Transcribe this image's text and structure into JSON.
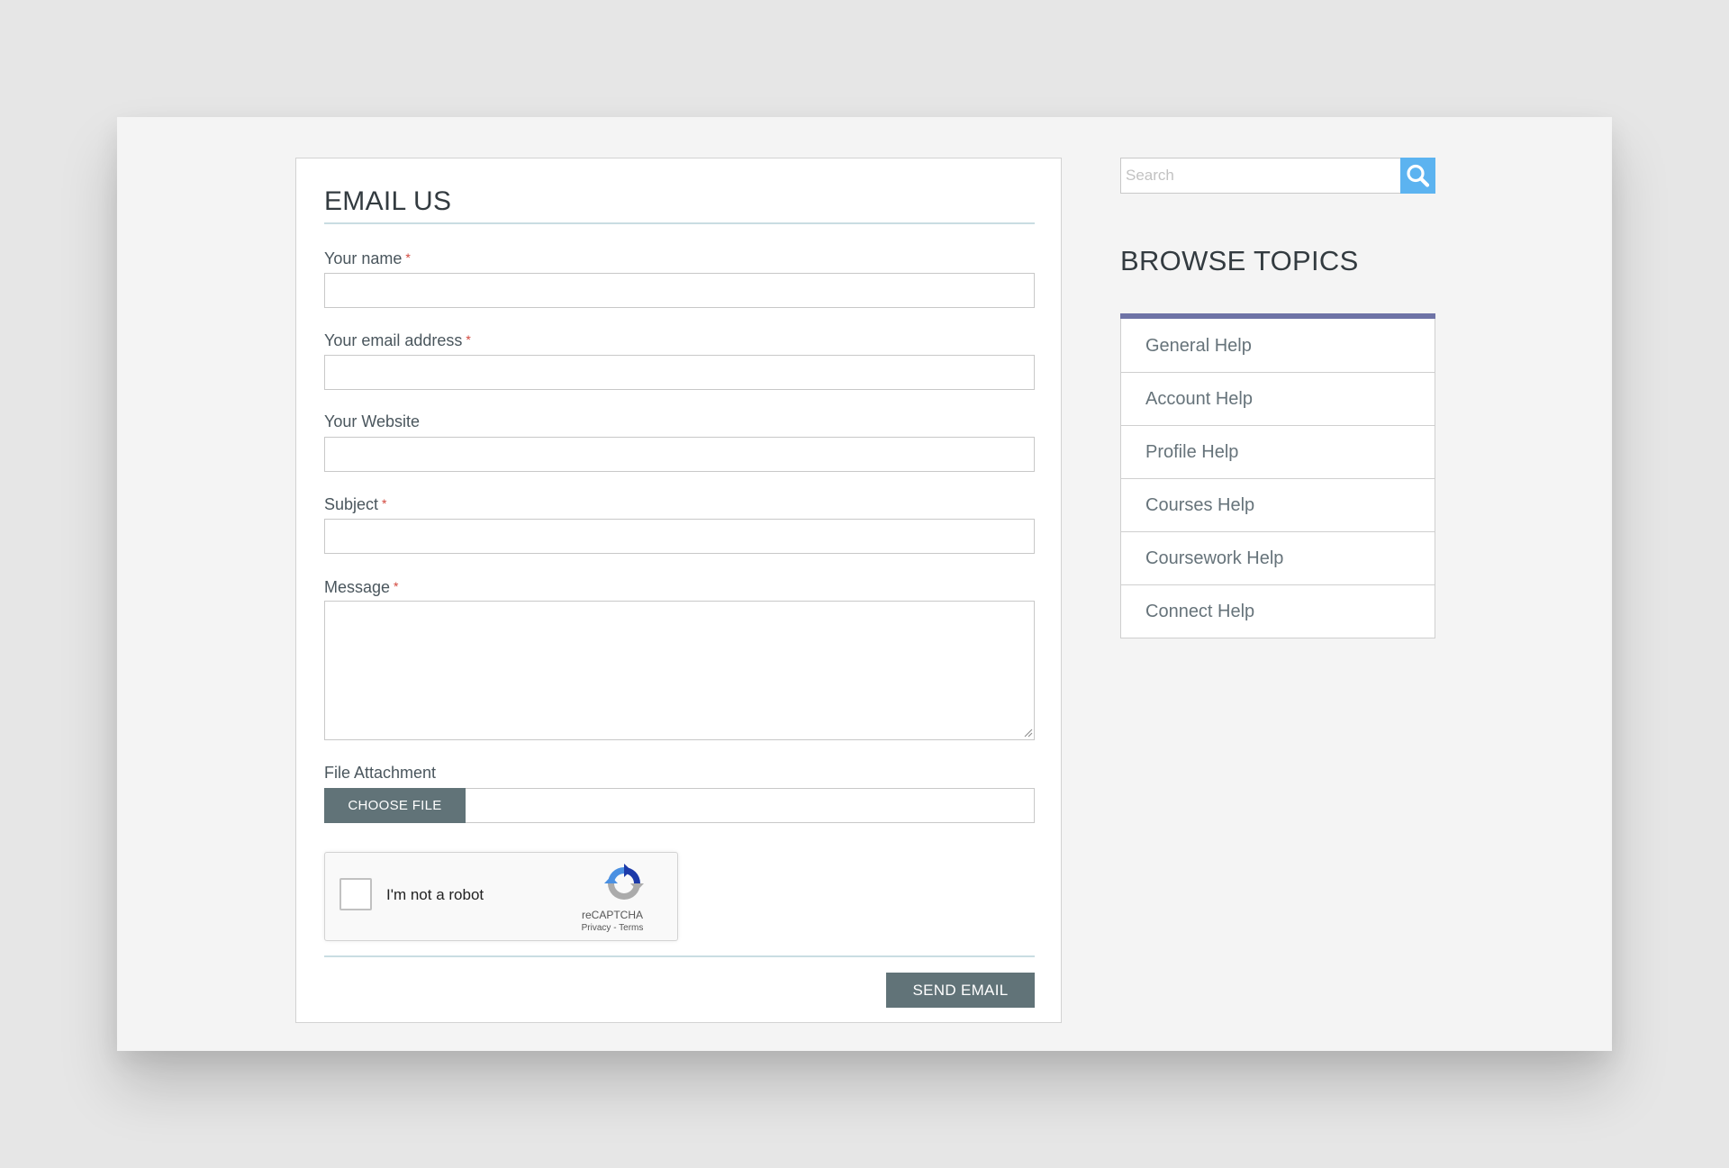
{
  "form": {
    "title": "EMAIL US",
    "required_mark": "*",
    "fields": {
      "name": {
        "label": "Your name",
        "value": ""
      },
      "email": {
        "label": "Your email address",
        "value": ""
      },
      "website": {
        "label": "Your Website",
        "value": ""
      },
      "subject": {
        "label": "Subject",
        "value": ""
      },
      "message": {
        "label": "Message",
        "value": ""
      }
    },
    "attachment": {
      "label": "File Attachment",
      "button_label": "CHOOSE FILE"
    },
    "captcha": {
      "label": "I'm not a robot",
      "brand": "reCAPTCHA",
      "links": "Privacy - Terms"
    },
    "submit_label": "SEND EMAIL"
  },
  "sidebar": {
    "search": {
      "placeholder": "Search"
    },
    "browse_title": "BROWSE TOPICS",
    "topics": [
      {
        "label": "General Help"
      },
      {
        "label": "Account Help"
      },
      {
        "label": "Profile Help"
      },
      {
        "label": "Courses Help"
      },
      {
        "label": "Coursework Help"
      },
      {
        "label": "Connect Help"
      }
    ]
  },
  "colors": {
    "button_bg": "#617378",
    "search_accent": "#5cb3f0",
    "topics_accent": "#6e73a6",
    "required": "#d2463c"
  },
  "icons": {
    "search": "magnifier-icon",
    "captcha": "recaptcha-logo-icon"
  }
}
